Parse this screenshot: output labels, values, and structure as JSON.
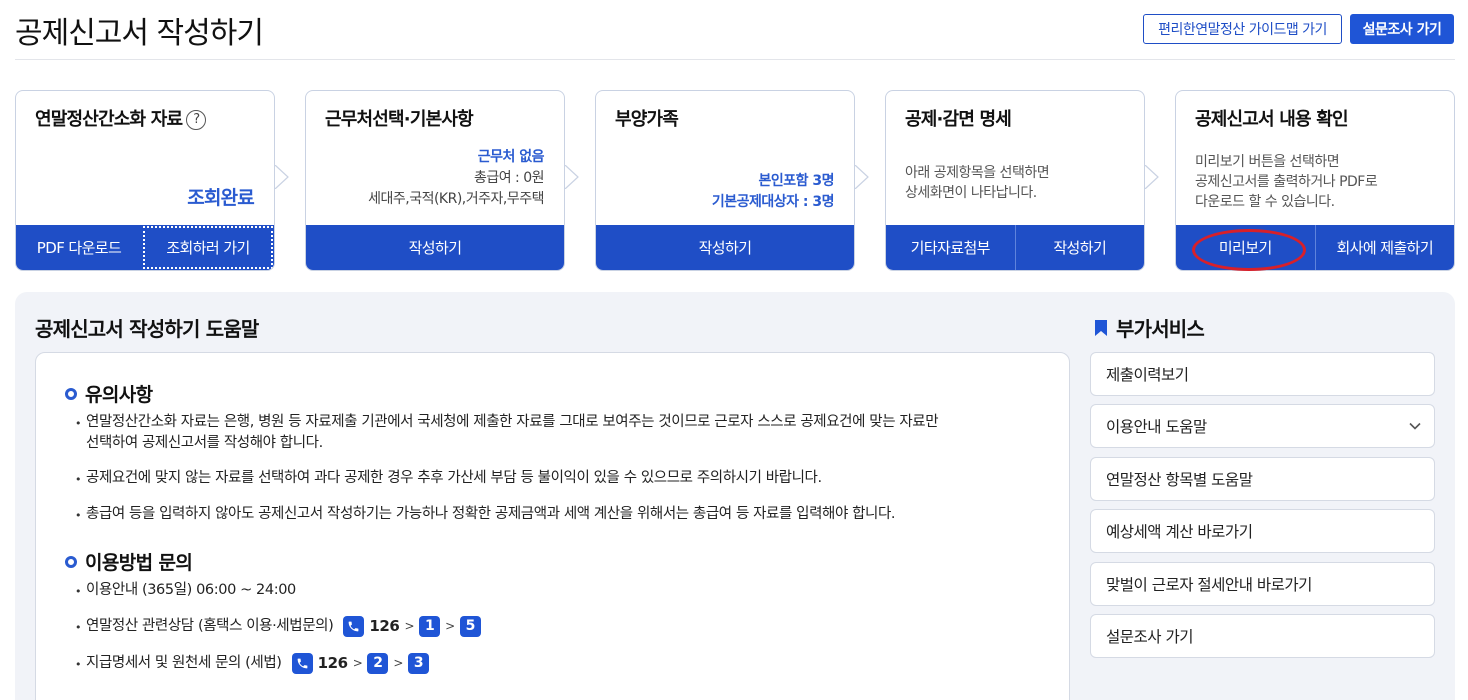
{
  "page": {
    "title": "공제신고서 작성하기",
    "guide_button": "편리한연말정산 가이드맵 가기",
    "survey_button": "설문조사 가기"
  },
  "cards": {
    "simplified": {
      "title": "연말정산간소화 자료",
      "help_icon": "?",
      "status": "조회완료",
      "btn_pdf": "PDF 다운로드",
      "btn_lookup": "조회하러 가기"
    },
    "workplace": {
      "title": "근무처선택·기본사항",
      "line1": "근무처 없음",
      "line2": "총급여 : 0원",
      "line3": "세대주,국적(KR),거주자,무주택",
      "btn": "작성하기"
    },
    "dependents": {
      "title": "부양가족",
      "line1": "본인포함 3명",
      "line2": "기본공제대상자 : 3명",
      "btn": "작성하기"
    },
    "deduction": {
      "title": "공제·감면 명세",
      "desc1": "아래 공제항목을 선택하면",
      "desc2": "상세화면이 나타납니다.",
      "btn_other": "기타자료첨부",
      "btn": "작성하기"
    },
    "confirm": {
      "title": "공제신고서 내용 확인",
      "desc1": "미리보기 버튼을 선택하면",
      "desc2": "공제신고서를 출력하거나 PDF로",
      "desc3": "다운로드 할 수 있습니다.",
      "btn_preview": "미리보기",
      "btn_submit": "회사에 제출하기"
    }
  },
  "help": {
    "title": "공제신고서 작성하기 도움말",
    "notes_title": "유의사항",
    "note1_line1": "연말정산간소화 자료는 은행, 병원 등 자료제출 기관에서 국세청에 제출한 자료를 그대로 보여주는 것이므로 근로자 스스로 공제요건에 맞는 자료만",
    "note1_line2": "선택하여 공제신고서를 작성해야 합니다.",
    "note2": "공제요건에 맞지 않는 자료를 선택하여 과다 공제한 경우 추후 가산세 부담 등 불이익이 있을 수 있으므로 주의하시기 바랍니다.",
    "note3": "총급여 등을 입력하지 않아도 공제신고서 작성하기는 가능하나 정확한 공제금액과 세액 계산을 위해서는 총급여 등 자료를 입력해야 합니다.",
    "inquiry_title": "이용방법 문의",
    "inq1": "이용안내 (365일) 06:00 ~ 24:00",
    "inq2_label": "연말정산 관련상담 (홈택스 이용·세법문의)",
    "inq2_number": "126",
    "inq2_key1": "1",
    "inq2_key2": "5",
    "inq3_label": "지급명세서 및 원천세 문의 (세법)",
    "inq3_number": "126",
    "inq3_key1": "2",
    "inq3_key2": "3",
    "separator": ">"
  },
  "side": {
    "title": "부가서비스",
    "items": [
      "제출이력보기",
      "이용안내 도움말",
      "연말정산 항목별 도움말",
      "예상세액 계산 바로가기",
      "맞벌이 근로자 절세안내 바로가기",
      "설문조사 가기"
    ]
  },
  "colors": {
    "primary": "#1f4ec6",
    "highlight_ring": "#d8202a",
    "panel_bg": "#f1f3f8"
  }
}
